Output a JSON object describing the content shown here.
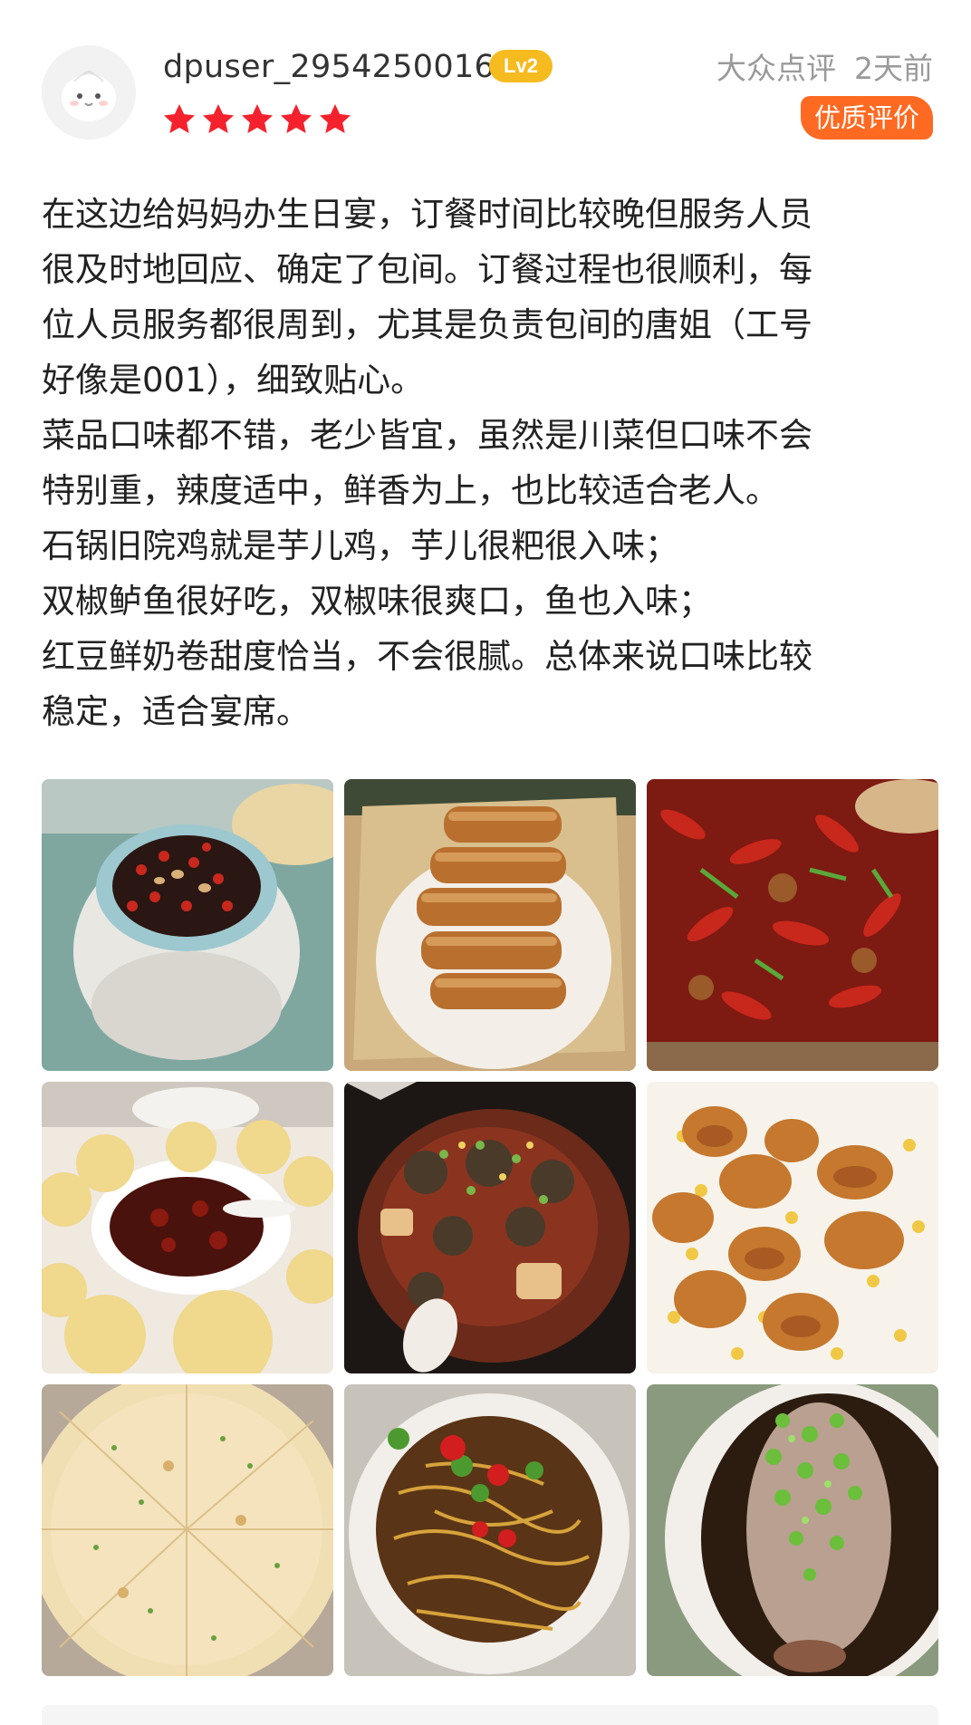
{
  "header": {
    "username": "dpuser_29542500160",
    "level": "Lv2",
    "rating": 5,
    "source": "大众点评",
    "time": "2天前",
    "quality_badge": "优质评价"
  },
  "icons": {
    "star": "star-icon",
    "avatar": "default-avatar-icon"
  },
  "colors": {
    "star": "#f5222d",
    "level_badge": "#f6bb1f",
    "quality_badge": "#ff6a22",
    "meta_text": "#9a9a9a"
  },
  "review": {
    "lines": [
      "在这边给妈妈办生日宴，订餐时间比较晚但服务人员",
      "很及时地回应、确定了包间。订餐过程也很顺利，每",
      "位人员服务都很周到，尤其是负责包间的唐姐（工号",
      "好像是001），细致贴心。",
      "菜品口味都不错，老少皆宜，虽然是川菜但口味不会",
      "特别重，辣度适中，鲜香为上，也比较适合老人。",
      "石锅旧院鸡就是芋儿鸡，芋儿很粑很入味；",
      "双椒鲈鱼很好吃，双椒味很爽口，鱼也入味；",
      "红豆鲜奶卷甜度恰当，不会很腻。总体来说口味比较",
      "稳定，适合宴席。"
    ]
  },
  "photos": {
    "count": 9
  }
}
